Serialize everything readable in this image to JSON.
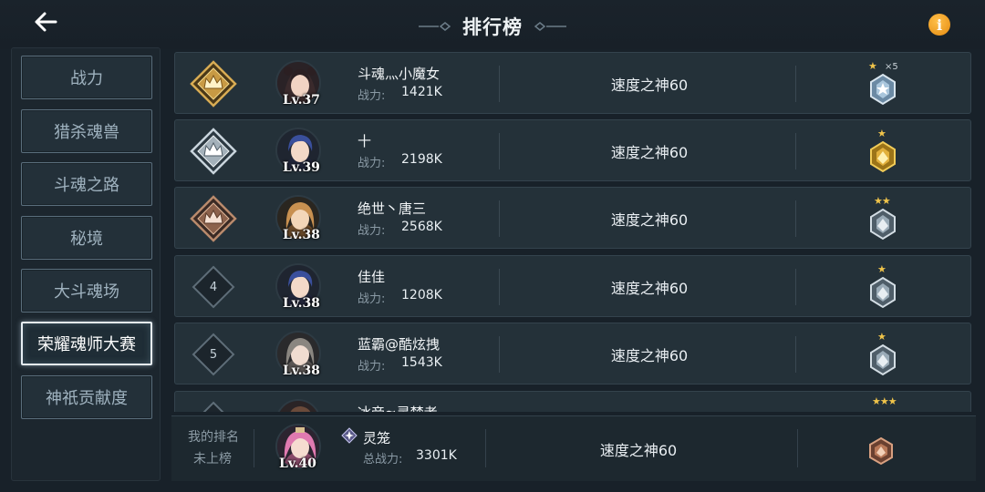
{
  "header": {
    "title": "排行榜",
    "back_icon": "arrow-left-icon",
    "info_label": "i"
  },
  "colors": {
    "accent": "#e8961c",
    "gold": "#d4a84a",
    "silver": "#c9d4dc",
    "bronze": "#b07a5a"
  },
  "sidebar": {
    "items": [
      {
        "label": "战力",
        "active": false
      },
      {
        "label": "猎杀魂兽",
        "active": false
      },
      {
        "label": "斗魂之路",
        "active": false
      },
      {
        "label": "秘境",
        "active": false
      },
      {
        "label": "大斗魂场",
        "active": false
      },
      {
        "label": "荣耀魂师大赛",
        "active": true
      },
      {
        "label": "神祇贡献度",
        "active": false
      }
    ]
  },
  "rows": [
    {
      "rank": "1",
      "rank_icon": "gold-crown-badge-icon",
      "level": "Lv.37",
      "name": "斗魂灬小魔女",
      "power_label": "战力:",
      "power": "1421K",
      "guild": "速度之神60",
      "stars": "★",
      "stars_multiplier": "×5",
      "medal": "silver-star-medal-icon"
    },
    {
      "rank": "2",
      "rank_icon": "silver-crown-badge-icon",
      "level": "Lv.39",
      "name": "十",
      "power_label": "战力:",
      "power": "2198K",
      "guild": "速度之神60",
      "stars": "★",
      "stars_multiplier": "",
      "medal": "gold-medal-icon"
    },
    {
      "rank": "3",
      "rank_icon": "bronze-crown-badge-icon",
      "level": "Lv.38",
      "name": "绝世丶唐三",
      "power_label": "战力:",
      "power": "2568K",
      "guild": "速度之神60",
      "stars": "★★",
      "stars_multiplier": "",
      "medal": "silver-medal-icon"
    },
    {
      "rank": "4",
      "rank_icon": "diamond-rank-icon",
      "level": "Lv.38",
      "name": "佳佳",
      "power_label": "战力:",
      "power": "1208K",
      "guild": "速度之神60",
      "stars": "★",
      "stars_multiplier": "",
      "medal": "silver-medal-icon"
    },
    {
      "rank": "5",
      "rank_icon": "diamond-rank-icon",
      "level": "Lv.38",
      "name": "蓝霸@酷炫拽",
      "power_label": "战力:",
      "power": "1543K",
      "guild": "速度之神60",
      "stars": "★",
      "stars_multiplier": "",
      "medal": "silver-medal-icon"
    },
    {
      "rank": "",
      "rank_icon": "diamond-rank-icon",
      "level": "",
      "name": "冰帝≈灵梦者",
      "power_label": "",
      "power": "",
      "guild": "",
      "stars": "★★★",
      "stars_multiplier": "",
      "medal": "silver-medal-icon"
    }
  ],
  "my_rank": {
    "label": "我的排名",
    "status": "未上榜",
    "level": "Lv.40",
    "name": "灵笼",
    "power_label": "总战力:",
    "power": "3301K",
    "guild": "速度之神60",
    "medal": "bronze-medal-icon"
  }
}
